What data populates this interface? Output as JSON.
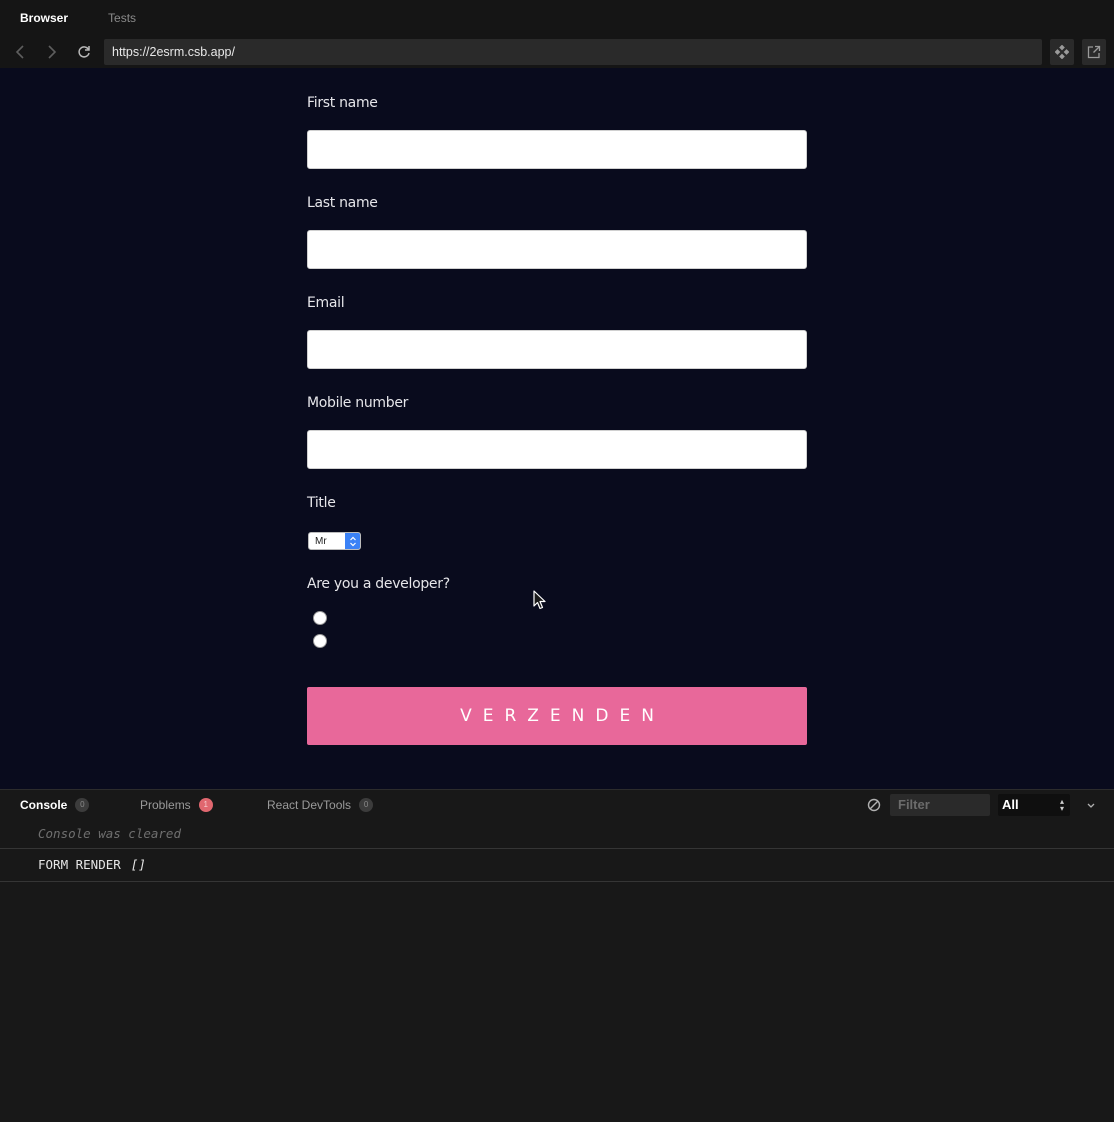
{
  "top_tabs": [
    {
      "label": "Browser",
      "active": true
    },
    {
      "label": "Tests",
      "active": false
    }
  ],
  "address_bar": {
    "url": "https://2esrm.csb.app/"
  },
  "form": {
    "first_name_label": "First name",
    "first_name_value": "",
    "last_name_label": "Last name",
    "last_name_value": "",
    "email_label": "Email",
    "email_value": "",
    "mobile_label": "Mobile number",
    "mobile_value": "",
    "title_label": "Title",
    "title_selected": "Mr",
    "developer_label": "Are you a developer?",
    "submit_label": "VERZENDEN"
  },
  "console": {
    "tabs": [
      {
        "label": "Console",
        "count": "0"
      },
      {
        "label": "Problems",
        "count": "1"
      },
      {
        "label": "React DevTools",
        "count": "0"
      }
    ],
    "filter_placeholder": "Filter",
    "level": "All",
    "cleared_message": "Console was cleared",
    "log": {
      "message": "FORM RENDER",
      "arg": "[]"
    }
  },
  "colors": {
    "preview_bg": "#090b1d",
    "submit_bg": "#e8689a",
    "problems_badge": "#e0676f"
  }
}
